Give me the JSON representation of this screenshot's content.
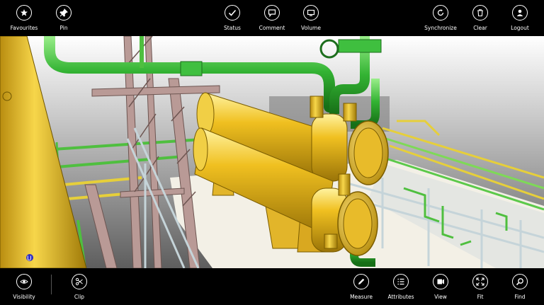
{
  "top_bar": {
    "left": [
      {
        "label": "Favourites",
        "icon": "star-icon"
      },
      {
        "label": "Pin",
        "icon": "pin-icon"
      }
    ],
    "center": [
      {
        "label": "Status",
        "icon": "check-icon"
      },
      {
        "label": "Comment",
        "icon": "comment-icon"
      },
      {
        "label": "Volume",
        "icon": "volume-icon"
      }
    ],
    "right": [
      {
        "label": "Synchronize",
        "icon": "sync-icon"
      },
      {
        "label": "Clear",
        "icon": "trash-icon"
      },
      {
        "label": "Logout",
        "icon": "user-icon"
      }
    ]
  },
  "bottom_bar": {
    "left": [
      {
        "label": "Visibility",
        "icon": "eye-icon"
      },
      {
        "label": "Clip",
        "icon": "scissors-icon"
      }
    ],
    "right": [
      {
        "label": "Measure",
        "icon": "pencil-icon"
      },
      {
        "label": "Attributes",
        "icon": "list-icon"
      },
      {
        "label": "View",
        "icon": "view-icon"
      },
      {
        "label": "Fit",
        "icon": "fit-icon"
      },
      {
        "label": "Find",
        "icon": "search-icon"
      }
    ]
  },
  "viewport": {
    "navigation_cube_label": "U",
    "colors": {
      "structure": "#f0c020",
      "pipe": "#33b333",
      "frame": "#b99a96",
      "rail": "#c5d4d9",
      "deck": "#f3f0e6"
    }
  }
}
